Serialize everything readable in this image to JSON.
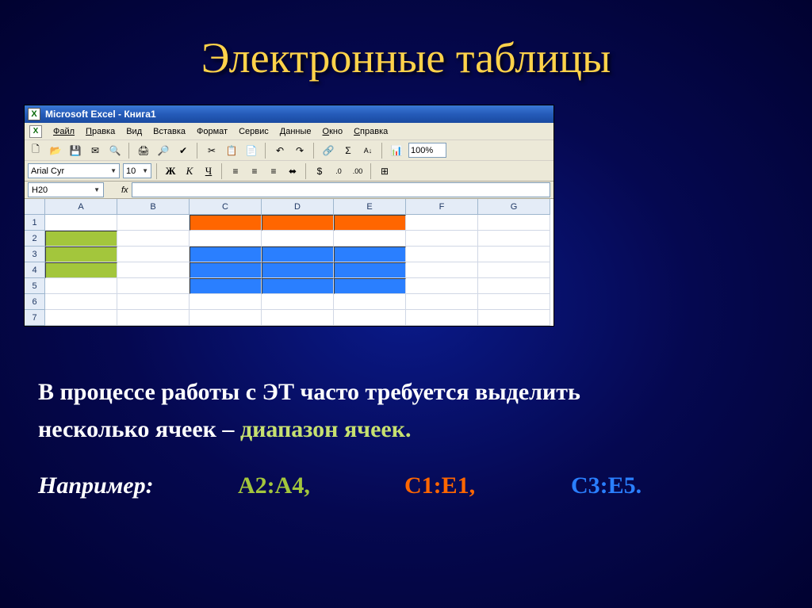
{
  "slide": {
    "title": "Электронные таблицы",
    "body_line1": "В процессе работы с ЭТ часто требуется выделить",
    "body_line2_a": "несколько ячеек – ",
    "body_line2_highlight": "диапазон ячеек.",
    "example_label": "Например:",
    "range1": "А2:А4,",
    "range2": "С1:Е1,",
    "range3": "С3:Е5."
  },
  "excel": {
    "app_title": "Microsoft Excel - Книга1",
    "menu": {
      "file": "Файл",
      "edit": "Правка",
      "view": "Вид",
      "insert": "Вставка",
      "format": "Формат",
      "tools": "Сервис",
      "data": "Данные",
      "window": "Окно",
      "help": "Справка"
    },
    "font_name": "Arial Cyr",
    "font_size": "10",
    "bold": "Ж",
    "italic": "К",
    "underline": "Ч",
    "zoom": "100%",
    "name_box": "H20",
    "fx_label": "fx",
    "columns": [
      "A",
      "B",
      "C",
      "D",
      "E",
      "F",
      "G"
    ],
    "rows": [
      "1",
      "2",
      "3",
      "4",
      "5",
      "6",
      "7"
    ],
    "cell_colors": {
      "A2": "green",
      "A3": "green",
      "A4": "green",
      "C1": "orange",
      "D1": "orange",
      "E1": "orange",
      "C3": "blue",
      "D3": "blue",
      "E3": "blue",
      "C4": "blue",
      "D4": "blue",
      "E4": "blue",
      "C5": "blue",
      "D5": "blue",
      "E5": "blue"
    }
  }
}
